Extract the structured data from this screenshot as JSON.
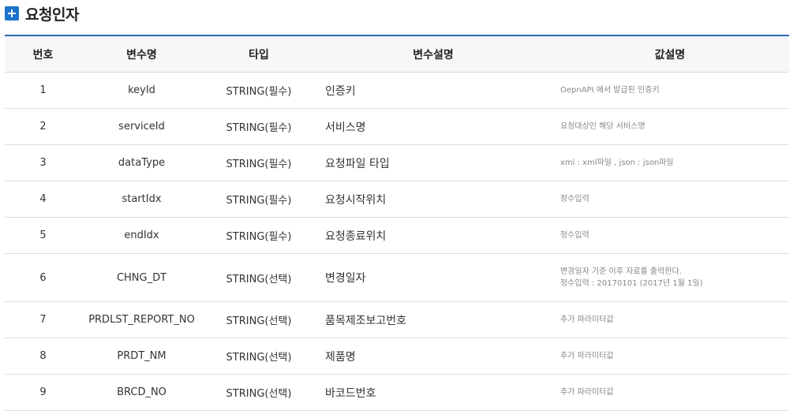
{
  "section": {
    "title": "요청인자"
  },
  "table": {
    "headers": [
      "번호",
      "변수명",
      "타입",
      "변수설명",
      "값설명"
    ],
    "rows": [
      {
        "num": "1",
        "var": "keyId",
        "type": "STRING(필수)",
        "desc": "인증키",
        "value": [
          "OepnAPI 에서 발급된 인증키"
        ]
      },
      {
        "num": "2",
        "var": "serviceId",
        "type": "STRING(필수)",
        "desc": "서비스명",
        "value": [
          "요청대상인 해당 서비스명"
        ]
      },
      {
        "num": "3",
        "var": "dataType",
        "type": "STRING(필수)",
        "desc": "요청파일 타입",
        "value": [
          "xml : xml파일 , json : json파일"
        ]
      },
      {
        "num": "4",
        "var": "startIdx",
        "type": "STRING(필수)",
        "desc": "요청시작위치",
        "value": [
          "정수입력"
        ]
      },
      {
        "num": "5",
        "var": "endIdx",
        "type": "STRING(필수)",
        "desc": "요청종료위치",
        "value": [
          "정수입력"
        ]
      },
      {
        "num": "6",
        "var": "CHNG_DT",
        "type": "STRING(선택)",
        "desc": "변경일자",
        "value": [
          "변경일자 기준 이후 자료를 출력한다.",
          "정수입력 : 20170101 (2017년 1월 1일)"
        ]
      },
      {
        "num": "7",
        "var": "PRDLST_REPORT_NO",
        "type": "STRING(선택)",
        "desc": "품목제조보고번호",
        "value": [
          "추가 파라미터값"
        ]
      },
      {
        "num": "8",
        "var": "PRDT_NM",
        "type": "STRING(선택)",
        "desc": "제품명",
        "value": [
          "추가 파라미터값"
        ]
      },
      {
        "num": "9",
        "var": "BRCD_NO",
        "type": "STRING(선택)",
        "desc": "바코드번호",
        "value": [
          "추가 파라미터값"
        ]
      }
    ]
  }
}
